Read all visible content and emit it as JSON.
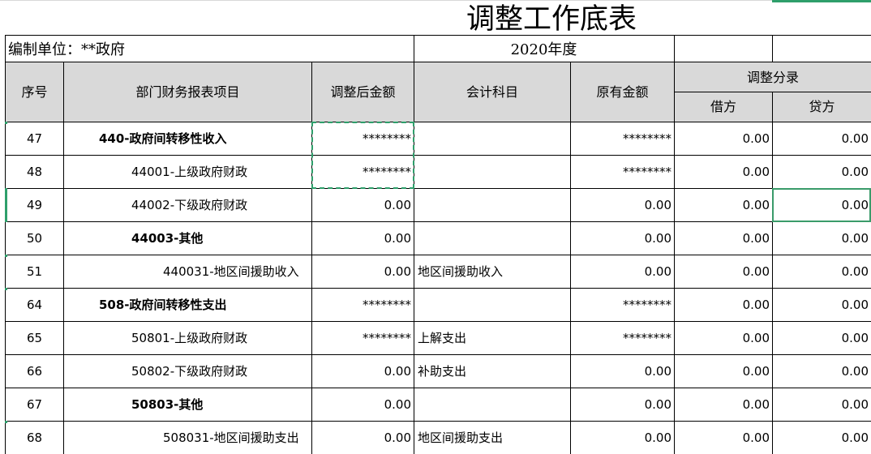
{
  "title": "调整工作底表",
  "unit_label": "编制单位：**政府",
  "year_label": "2020年度",
  "headers": {
    "seq": "序号",
    "item": "部门财务报表项目",
    "adjusted": "调整后金额",
    "account": "会计科目",
    "original": "原有金额",
    "entry": "调整分录",
    "debit": "借方",
    "credit": "贷方"
  },
  "rows": [
    {
      "seq": "47",
      "item": "440-政府间转移性收入",
      "adjusted": "********",
      "account": "",
      "original": "********",
      "debit": "0.00",
      "credit": "0.00"
    },
    {
      "seq": "48",
      "item": "44001-上级政府财政",
      "adjusted": "********",
      "account": "",
      "original": "********",
      "debit": "0.00",
      "credit": "0.00"
    },
    {
      "seq": "49",
      "item": "44002-下级政府财政",
      "adjusted": "0.00",
      "account": "",
      "original": "0.00",
      "debit": "0.00",
      "credit": "0.00"
    },
    {
      "seq": "50",
      "item": "44003-其他",
      "adjusted": "0.00",
      "account": "",
      "original": "0.00",
      "debit": "0.00",
      "credit": "0.00"
    },
    {
      "seq": "51",
      "item": "440031-地区间援助收入",
      "adjusted": "0.00",
      "account": "地区间援助收入",
      "original": "0.00",
      "debit": "0.00",
      "credit": "0.00"
    },
    {
      "seq": "64",
      "item": "508-政府间转移性支出",
      "adjusted": "********",
      "account": "",
      "original": "********",
      "debit": "0.00",
      "credit": "0.00"
    },
    {
      "seq": "65",
      "item": "50801-上级政府财政",
      "adjusted": "********",
      "account": "上解支出",
      "original": "********",
      "debit": "0.00",
      "credit": "0.00"
    },
    {
      "seq": "66",
      "item": "50802-下级政府财政",
      "adjusted": "0.00",
      "account": "补助支出",
      "original": "0.00",
      "debit": "0.00",
      "credit": "0.00"
    },
    {
      "seq": "67",
      "item": "50803-其他",
      "adjusted": "0.00",
      "account": "",
      "original": "0.00",
      "debit": "0.00",
      "credit": "0.00"
    },
    {
      "seq": "68",
      "item": "508031-地区间援助支出",
      "adjusted": "0.00",
      "account": "地区间援助支出",
      "original": "0.00",
      "debit": "0.00",
      "credit": "0.00"
    }
  ],
  "colors": {
    "header_fill": "#d9d9d9",
    "selection": "#3a9b6a",
    "copy_marquee": "#2e9f6b"
  }
}
